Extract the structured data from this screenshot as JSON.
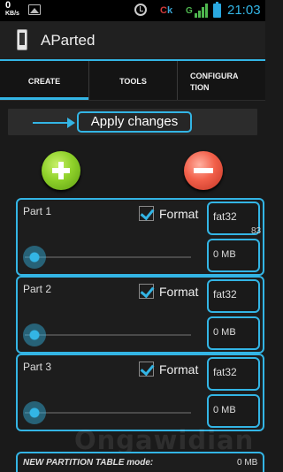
{
  "status_bar": {
    "speed_value": "0",
    "speed_unit": "KB/s",
    "carrier_text_c": "C",
    "carrier_text_k": "k",
    "signal_text": "G",
    "time": "21:03",
    "icons": [
      "image-icon",
      "alarm-icon",
      "signal-icon",
      "battery-icon"
    ]
  },
  "action_bar": {
    "title": "AParted",
    "icon": "sd-card-icon"
  },
  "tabs": [
    {
      "label": "CREATE",
      "selected": true
    },
    {
      "label": "TOOLS",
      "selected": false
    },
    {
      "label": "CONFIGURATION",
      "selected": false
    }
  ],
  "apply": {
    "label": "Apply changes",
    "icon": "arrow-right-icon"
  },
  "actions": {
    "add_icon": "plus-icon",
    "remove_icon": "minus-icon"
  },
  "partitions": [
    {
      "name": "Part 1",
      "format_label": "Format",
      "format_checked": true,
      "filesystem": "fat32",
      "size": "0 MB",
      "slider_value": 0
    },
    {
      "name": "Part 2",
      "format_label": "Format",
      "format_checked": true,
      "filesystem": "fat32",
      "size": "0 MB",
      "slider_value": 0
    },
    {
      "name": "Part 3",
      "format_label": "Format",
      "format_checked": true,
      "filesystem": "fat32",
      "size": "0 MB",
      "slider_value": 0
    }
  ],
  "side_number": "83",
  "bottom": {
    "label": "NEW PARTITION TABLE mode:",
    "size": "0 MB"
  },
  "watermark": "Ongawidian",
  "colors": {
    "accent": "#33b5e5",
    "add_green": "#8fd12a",
    "remove_red": "#f2604a",
    "background": "#1a1a1a"
  }
}
